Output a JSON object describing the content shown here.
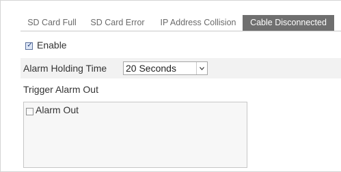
{
  "tabs": [
    {
      "label": "SD Card Full",
      "active": false
    },
    {
      "label": "SD Card Error",
      "active": false
    },
    {
      "label": "IP Address Collision",
      "active": false
    },
    {
      "label": "Cable Disconnected",
      "active": true
    }
  ],
  "enable": {
    "label": "Enable",
    "checked": true
  },
  "alarm_holding_time": {
    "label": "Alarm Holding Time",
    "selected": "20 Seconds"
  },
  "trigger_alarm_out": {
    "heading": "Trigger Alarm Out",
    "items": [
      {
        "label": "Alarm Out",
        "checked": false
      }
    ]
  },
  "colors": {
    "active_tab_bg": "#6f6f6f",
    "row_shade": "#f2f2f2",
    "tab_text": "#6a6a6a"
  }
}
